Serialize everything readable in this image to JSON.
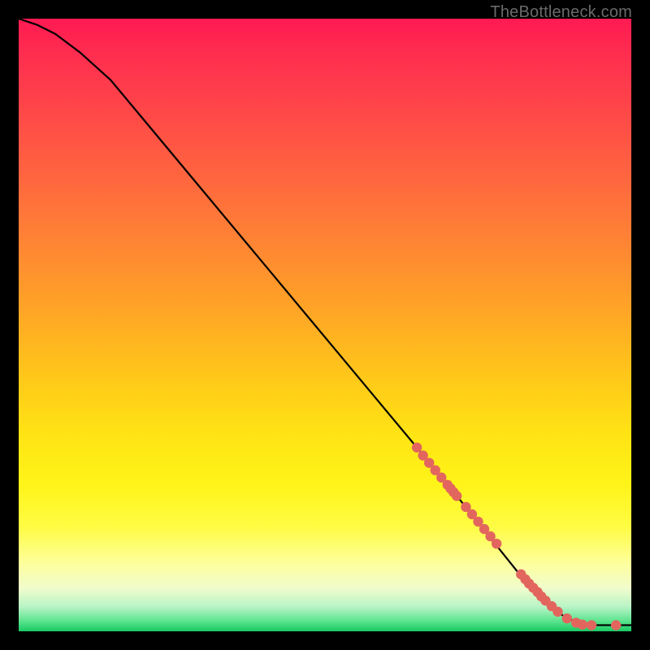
{
  "watermark": "TheBottleneck.com",
  "chart_data": {
    "type": "line",
    "title": "",
    "xlabel": "",
    "ylabel": "",
    "xlim": [
      0,
      100
    ],
    "ylim": [
      0,
      100
    ],
    "series": [
      {
        "name": "curve",
        "x": [
          0,
          3,
          6,
          10,
          15,
          20,
          30,
          40,
          50,
          60,
          70,
          78,
          82,
          85,
          88,
          91,
          94,
          97,
          100
        ],
        "y": [
          100,
          99,
          97.5,
          94.5,
          90,
          84,
          72,
          60,
          48,
          36,
          24,
          14,
          9,
          5.5,
          3,
          1.5,
          1,
          1,
          1
        ]
      }
    ],
    "scatter_points": {
      "name": "highlight-dots",
      "color": "#e2665e",
      "x": [
        65,
        66,
        67,
        68,
        69,
        70,
        70.5,
        71,
        71.5,
        73,
        74,
        75,
        76,
        77,
        78,
        82,
        82.7,
        83.3,
        84,
        84.7,
        85.3,
        86,
        87,
        88,
        89.5,
        91,
        92,
        93.5,
        97.5
      ],
      "y": [
        30,
        28.7,
        27.5,
        26.3,
        25.1,
        23.9,
        23.3,
        22.7,
        22.1,
        20.3,
        19.1,
        17.9,
        16.7,
        15.5,
        14.3,
        9.3,
        8.5,
        7.8,
        7.1,
        6.4,
        5.7,
        5,
        4.1,
        3.2,
        2.1,
        1.4,
        1.1,
        1,
        1
      ]
    }
  }
}
